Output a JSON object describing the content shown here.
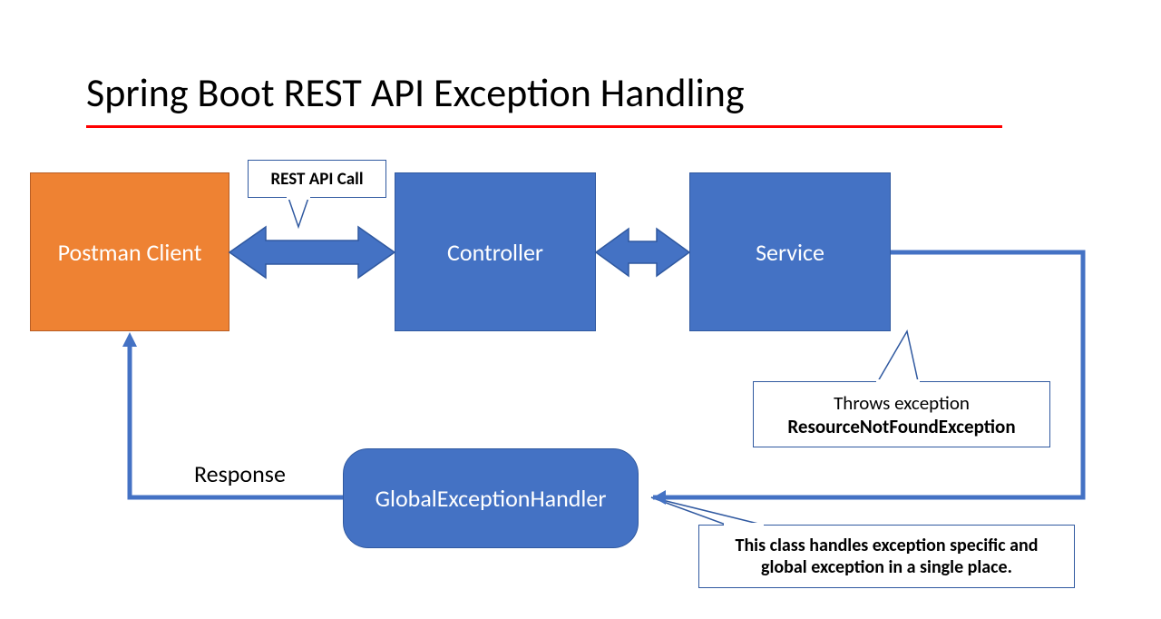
{
  "title": "Spring Boot REST API Exception Handling",
  "boxes": {
    "postman": "Postman Client",
    "controller": "Controller",
    "service": "Service",
    "handler": "GlobalExceptionHandler"
  },
  "callouts": {
    "rest_api": "REST API Call",
    "throws_line1": "Throws exception",
    "throws_line2": "ResourceNotFoundException",
    "handler_desc_line1": "This class handles exception specific and",
    "handler_desc_line2": "global exception in a single place."
  },
  "labels": {
    "response": "Response"
  },
  "colors": {
    "orange": "#ee8233",
    "blue": "#4472c4",
    "red": "#ff0000"
  }
}
